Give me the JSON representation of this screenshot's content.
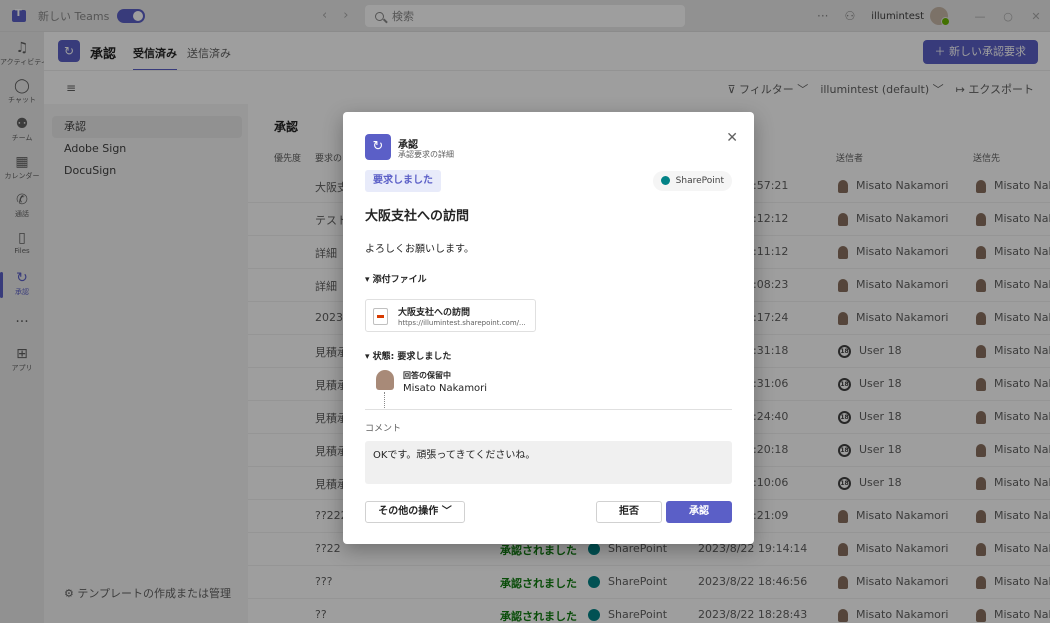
{
  "titlebar": {
    "new_teams_label": "新しい Teams",
    "search_placeholder": "検索",
    "more_label": "···",
    "user_name": "illumintest",
    "minimize": "—",
    "restore": "○",
    "close": "✕"
  },
  "rail": {
    "items": [
      {
        "label": "アクティビティ",
        "icon": "bell-icon"
      },
      {
        "label": "チャット",
        "icon": "chat-icon"
      },
      {
        "label": "チーム",
        "icon": "teams-icon"
      },
      {
        "label": "カレンダー",
        "icon": "calendar-icon"
      },
      {
        "label": "通話",
        "icon": "phone-icon"
      },
      {
        "label": "Files",
        "icon": "file-icon"
      },
      {
        "label": "承認",
        "icon": "approvals-icon"
      },
      {
        "label": "",
        "icon": "more-icon"
      },
      {
        "label": "アプリ",
        "icon": "apps-icon"
      }
    ]
  },
  "app": {
    "title": "承認",
    "tab_received": "受信済み",
    "tab_sent": "送信済み",
    "new_request": "＋ 新しい承認要求"
  },
  "toolbar": {
    "filter": "フィルター",
    "tenant": "illumintest (default)",
    "export": "エクスポート"
  },
  "sidelist": {
    "items": [
      "承認",
      "Adobe Sign",
      "DocuSign"
    ],
    "template_link": "テンプレートの作成または管理"
  },
  "table": {
    "title": "承認",
    "headers": {
      "priority": "優先度",
      "name": "要求の",
      "sender": "送信者",
      "recipient": "送信先"
    },
    "rows": [
      {
        "name": "大阪支",
        "status": "",
        "source": "",
        "date": ":57:21",
        "sender": "Misato Nakamori",
        "sender_type": "person",
        "recipient": "Misato Naka"
      },
      {
        "name": "テスト",
        "status": "",
        "source": "",
        "date": ":12:12",
        "sender": "Misato Nakamori",
        "sender_type": "person",
        "recipient": "Misato Naka"
      },
      {
        "name": "詳細",
        "status": "",
        "source": "",
        "date": ":11:12",
        "sender": "Misato Nakamori",
        "sender_type": "person",
        "recipient": "Misato Naka"
      },
      {
        "name": "詳細",
        "status": "",
        "source": "",
        "date": ":08:23",
        "sender": "Misato Nakamori",
        "sender_type": "person",
        "recipient": "Misato Naka"
      },
      {
        "name": "2023/",
        "status": "",
        "source": "",
        "date": ":17:24",
        "sender": "Misato Nakamori",
        "sender_type": "person",
        "recipient": "Misato Naka"
      },
      {
        "name": "見積承",
        "status": "",
        "source": "",
        "date": ":31:18",
        "sender": "User 18",
        "sender_type": "user",
        "recipient": "Misato Naka"
      },
      {
        "name": "見積承",
        "status": "",
        "source": "",
        "date": ":31:06",
        "sender": "User 18",
        "sender_type": "user",
        "recipient": "Misato Naka"
      },
      {
        "name": "見積承",
        "status": "",
        "source": "",
        "date": ":24:40",
        "sender": "User 18",
        "sender_type": "user",
        "recipient": "Misato Naka"
      },
      {
        "name": "見積承",
        "status": "",
        "source": "",
        "date": ":20:18",
        "sender": "User 18",
        "sender_type": "user",
        "recipient": "Misato Naka"
      },
      {
        "name": "見積承",
        "status": "",
        "source": "",
        "date": ":10:06",
        "sender": "User 18",
        "sender_type": "user",
        "recipient": "Misato Naka"
      },
      {
        "name": "??222",
        "status": "",
        "source": "",
        "date": ":21:09",
        "sender": "Misato Nakamori",
        "sender_type": "person",
        "recipient": "Misato Naka"
      },
      {
        "name": "??22",
        "status": "承認されました",
        "source": "SharePoint",
        "date": "2023/8/22 19:14:14",
        "sender": "Misato Nakamori",
        "sender_type": "person",
        "recipient": "Misato Naka"
      },
      {
        "name": "???",
        "status": "承認されました",
        "source": "SharePoint",
        "date": "2023/8/22 18:46:56",
        "sender": "Misato Nakamori",
        "sender_type": "person",
        "recipient": "Misato Naka"
      },
      {
        "name": "??",
        "status": "承認されました",
        "source": "SharePoint",
        "date": "2023/8/22 18:28:43",
        "sender": "Misato Nakamori",
        "sender_type": "person",
        "recipient": "Misato Naka"
      }
    ]
  },
  "modal": {
    "title": "承認",
    "subtitle": "承認要求の詳細",
    "close": "✕",
    "status_badge": "要求しました",
    "source": "SharePoint",
    "heading": "大阪支社への訪問",
    "message": "よろしくお願いします。",
    "attachments_label": "▾ 添付ファイル",
    "file_name": "大阪支社への訪問",
    "file_url": "https://illumintest.sharepoint.com/...",
    "status_label": "▾ 状態: 要求しました",
    "response_label": "回答の保留中",
    "responder": "Misato Nakamori",
    "comment_label": "コメント",
    "comment_text": "OKです。頑張ってきてくださいね。",
    "more_actions": "その他の操作 ﹀",
    "reject": "拒否",
    "approve": "承認"
  },
  "colors": {
    "accent": "#5b5fc7",
    "approved": "#107c10",
    "sharepoint": "#038387"
  }
}
